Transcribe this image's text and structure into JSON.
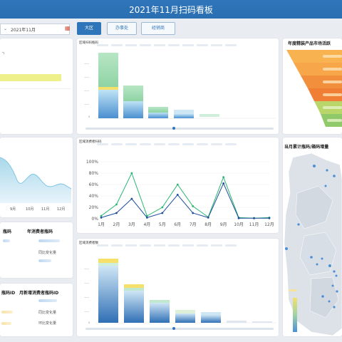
{
  "header": {
    "title": "2021年11月扫码看板"
  },
  "filter": {
    "date_value": "2021年11月"
  },
  "tabs": [
    {
      "label": "大区"
    },
    {
      "label": "办事处"
    },
    {
      "label": "经销商"
    }
  ],
  "colors": {
    "header": "#2f75b9",
    "green": "#2bb673",
    "blue": "#1f4e9c",
    "accent_yellow": "#f4e06a"
  },
  "cards": {
    "region_scan_title": "区域扫码瓶码",
    "region_consumer_title": "区域消费者扫码",
    "region_consumer_count_title": "区域消费者数",
    "funnel_title": "年度精装产品市场活跃",
    "map_title": "当月累计瓶码/箱码增量"
  },
  "kpis": {
    "left_top_1": "瓶码",
    "left_top_2": "年消费者瓶码",
    "yoy_label": "同比变化量",
    "left_bottom_1": "瓶码ID",
    "left_bottom_2": "月新增消费者瓶码ID",
    "yoy_label_2": "同比变化量",
    "mom_label": "环比变化量"
  },
  "left_area": {
    "x_labels": [
      "9月",
      "10月",
      "11月",
      "12月"
    ]
  },
  "chart_data": {
    "type": "line",
    "x": [
      "1月",
      "2月",
      "3月",
      "4月",
      "5月",
      "6月",
      "7月",
      "8月",
      "9月",
      "10月",
      "11月",
      "12月"
    ],
    "y_ticks": [
      "0%",
      "20%",
      "40%",
      "60%",
      "80%",
      "100%"
    ],
    "ylim": [
      0,
      100
    ],
    "series": [
      {
        "values": [
          5,
          25,
          80,
          5,
          20,
          60,
          22,
          3,
          73,
          2,
          1,
          2
        ]
      },
      {
        "values": [
          2,
          10,
          35,
          2,
          10,
          42,
          10,
          2,
          62,
          1,
          1,
          1
        ]
      }
    ]
  }
}
